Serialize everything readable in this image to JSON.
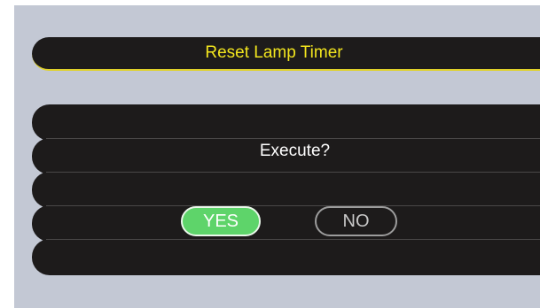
{
  "dialog": {
    "title": "Reset Lamp Timer",
    "prompt": "Execute?",
    "yes_label": "YES",
    "no_label": "NO",
    "selected": "YES"
  },
  "colors": {
    "screen_background": "#c3c8d4",
    "bar_background": "#1d1b1b",
    "title_text": "#f2e51e",
    "title_underline": "#e0d12a",
    "prompt_text": "#ffffff",
    "yes_button_fill": "#5ed46a",
    "no_button_outline": "#9c9c9c"
  }
}
